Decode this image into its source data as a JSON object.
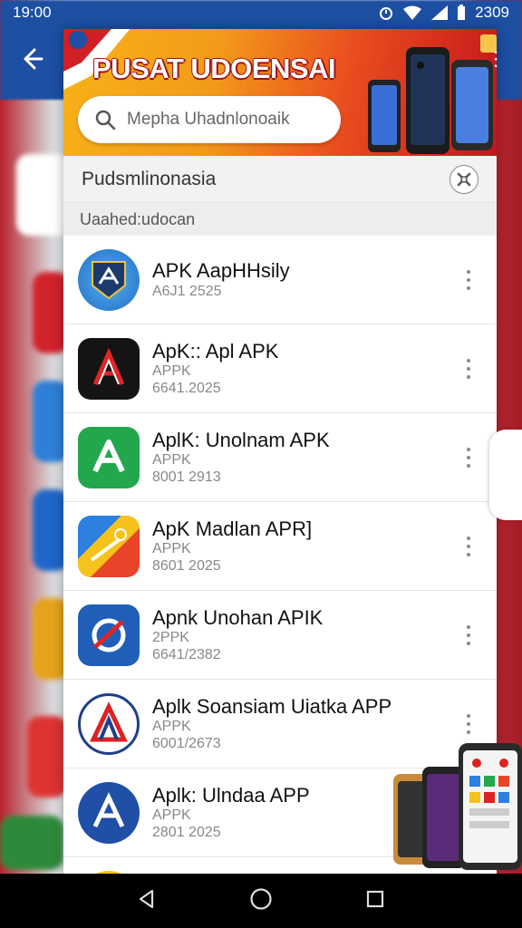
{
  "status_bar": {
    "time": "19:00",
    "right_text": "2309"
  },
  "banner": {
    "title": "PUSAT UDOENSAI",
    "search_placeholder": "Mepha Uhadnlonoaik"
  },
  "section": {
    "title": "Pudsmlinonasia"
  },
  "subheader": {
    "label": "Uaahed:udocan"
  },
  "apps": [
    {
      "name": "APK AapHHsily",
      "type": "",
      "date": "A6J1 2525"
    },
    {
      "name": "ApK:: Apl APK",
      "type": "APPK",
      "date": "6641.2025"
    },
    {
      "name": "AplK: Unolnam APK",
      "type": "APPK",
      "date": "8001 2913"
    },
    {
      "name": "ApK Madlan APR]",
      "type": "APPK",
      "date": "8601 2025"
    },
    {
      "name": "Apnk Unohan APIK",
      "type": "2PPK",
      "date": "6641/2382"
    },
    {
      "name": "Aplk Soansiam Uiatka APP",
      "type": "APPK",
      "date": "6001/2673"
    },
    {
      "name": "Aplk: Ulndaa APP",
      "type": "APPK",
      "date": "2801 2025"
    }
  ],
  "icons": {
    "back": "arrow-left-icon",
    "search": "search-icon",
    "section_action": "logo-icon",
    "more": "more-vertical-icon",
    "nav_back": "triangle-back-icon",
    "nav_home": "circle-home-icon",
    "nav_recents": "square-recents-icon"
  },
  "colors": {
    "banner_start": "#f7b218",
    "banner_end": "#c4161c",
    "status_bar_bg": "#1d4fa3",
    "nav_bar": "#000000"
  }
}
